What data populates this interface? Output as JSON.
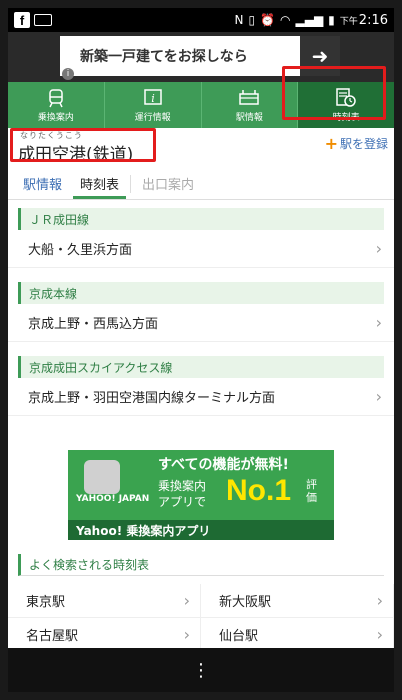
{
  "status_bar": {
    "fb_icon": "f",
    "icons": [
      "nfc-icon",
      "vibrate-icon",
      "alarm-icon",
      "wifi-icon",
      "signal-icon",
      "battery-icon"
    ],
    "ampm": "下午",
    "time": "2:16"
  },
  "ad": {
    "text": "新築一戸建てをお探しなら",
    "arrow": "➜",
    "info": "i"
  },
  "nav": {
    "tabs": [
      {
        "label": "乗換案内",
        "icon": "train-icon"
      },
      {
        "label": "運行情報",
        "icon": "info-icon"
      },
      {
        "label": "駅情報",
        "icon": "station-icon"
      },
      {
        "label": "時刻表",
        "icon": "timetable-icon"
      }
    ]
  },
  "station": {
    "ruby": "なりたくうこう",
    "name": "成田空港(鉄道)",
    "register_label": "駅を登録",
    "register_plus": "+"
  },
  "subtabs": {
    "info": "駅情報",
    "timetable": "時刻表",
    "exit": "出口案内"
  },
  "lines": [
    {
      "name": "ＪＲ成田線",
      "directions": [
        "大船・久里浜方面"
      ]
    },
    {
      "name": "京成本線",
      "directions": [
        "京成上野・西馬込方面"
      ]
    },
    {
      "name": "京成成田スカイアクセス線",
      "directions": [
        "京成上野・羽田空港国内線ターミナル方面"
      ]
    }
  ],
  "promo": {
    "top": "すべての機能が無料!",
    "mid1": "乗換案内",
    "mid2": "アプリで",
    "no1": "No.1",
    "hyoka": "評価",
    "yahoo": "YAHOO! JAPAN",
    "bottom": "Yahoo! 乗換案内アプリ"
  },
  "frequent": {
    "title": "よく検索される時刻表",
    "stations": [
      "東京駅",
      "新大阪駅",
      "名古屋駅",
      "仙台駅"
    ]
  },
  "bottom_bar": {
    "menu": "⋮"
  },
  "chevron": "›"
}
